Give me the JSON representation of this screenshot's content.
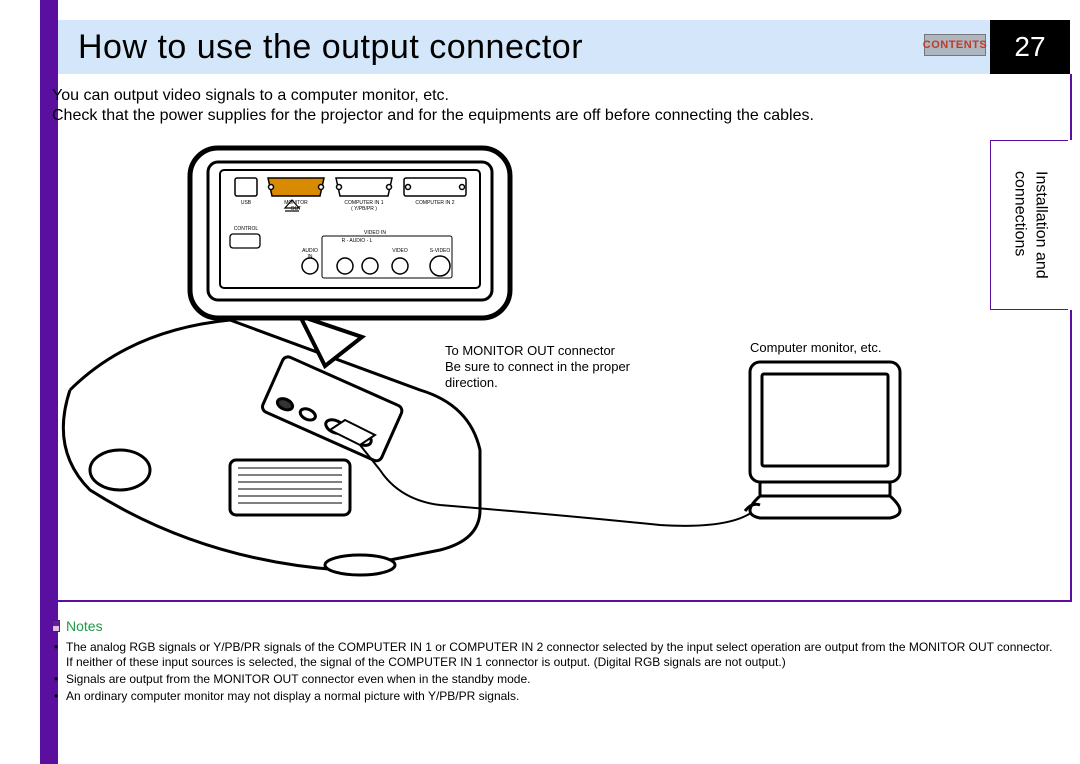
{
  "header": {
    "title": "How to use the output connector",
    "contents_label": "CONTENTS",
    "page_number": "27"
  },
  "intro": {
    "line1": "You can output video signals to a computer monitor, etc.",
    "line2": "Check that the power supplies for the projector and for the equipments are off before connecting the cables."
  },
  "side_tab": {
    "line1": "Installation and",
    "line2": "connections"
  },
  "diagram": {
    "callout_line1": "To MONITOR OUT connector",
    "callout_line2": "Be sure to connect in the proper",
    "callout_line3": "direction.",
    "monitor_label": "Computer monitor, etc.",
    "panel": {
      "usb": "USB",
      "monitor_out": "MONITOR\nOUT",
      "computer_in1": "COMPUTER IN 1\n(Y/PB/PR)",
      "computer_in2": "COMPUTER IN 2",
      "control": "CONTROL",
      "audio_in": "AUDIO\nIN",
      "r_audio_l": "R - AUDIO - L",
      "video_in": "VIDEO IN",
      "video": "VIDEO",
      "s_video": "S-VIDEO"
    }
  },
  "notes": {
    "heading": "Notes",
    "items": [
      "The analog RGB signals or Y/PB/PR signals of the COMPUTER IN 1 or COMPUTER IN 2 connector selected by the input select operation are output from the MONITOR OUT connector. If neither of these input sources is selected, the signal of the COMPUTER IN 1 connector is output. (Digital RGB signals are not output.)",
      "Signals are output from the MONITOR OUT connector even when in the standby mode.",
      "An ordinary computer monitor may not display a normal picture with Y/PB/PR signals."
    ]
  }
}
